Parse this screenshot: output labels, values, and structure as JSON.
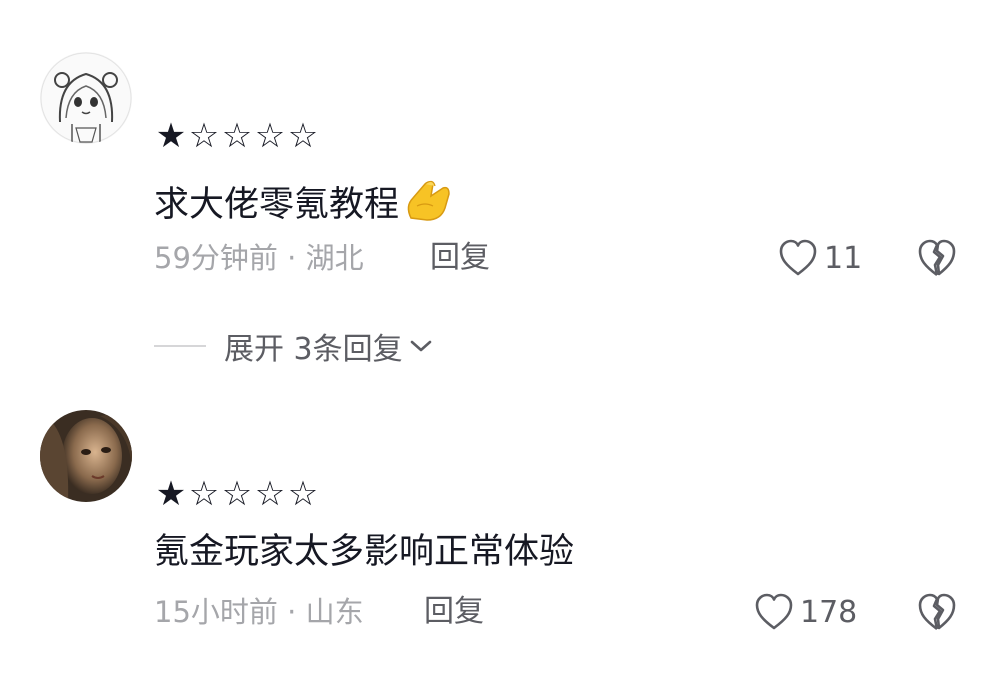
{
  "comments": [
    {
      "rating": 1,
      "max_rating": 5,
      "stars_text": "★☆☆☆☆",
      "text": "求大佬零氪教程",
      "emoji": "pinched-fingers-emoji",
      "time": "59分钟前",
      "sep": "·",
      "location": "湖北",
      "reply_label": "回复",
      "like_count": "11",
      "expand_label": "展开 3条回复"
    },
    {
      "rating": 1,
      "max_rating": 5,
      "stars_text": "★☆☆☆☆",
      "text": "氪金玩家太多影响正常体验",
      "time": "15小时前",
      "sep": "·",
      "location": "山东",
      "reply_label": "回复",
      "like_count": "178"
    }
  ],
  "colors": {
    "primary_text": "#161823",
    "secondary_text": "#a5a6aa",
    "action_text": "#5c5d63",
    "background": "#ffffff"
  },
  "icons": [
    "heart-outline-icon",
    "broken-heart-icon",
    "chevron-down-icon"
  ]
}
